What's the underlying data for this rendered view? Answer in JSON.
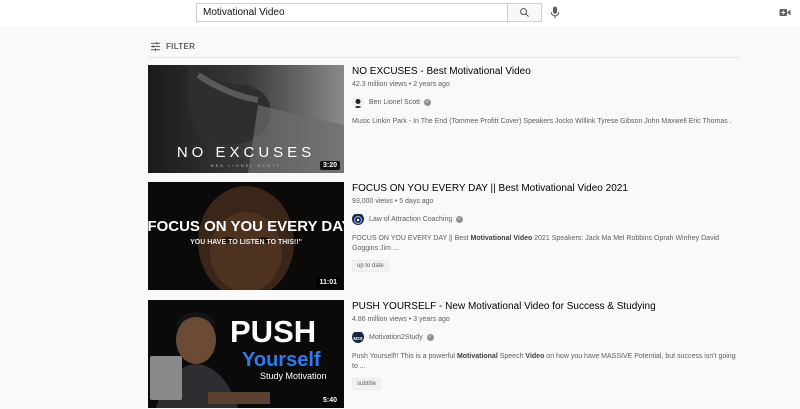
{
  "search": {
    "query": "Motivational Video"
  },
  "filter": {
    "label": "FILTER"
  },
  "results": [
    {
      "title": "NO EXCUSES - Best Motivational Video",
      "views": "42.3 million views",
      "age": "2 years ago",
      "channel": "Ben Lionel Scott",
      "description": "Music Linkin Park - In The End (Tommee Profitt Cover) Speakers Jocko Willink Tyrese Gibson John Maxwell Eric Thomas .",
      "duration": "3:20",
      "thumb_text": "NO EXCUSES",
      "thumb_sub": "BEN LIONEL SCOTT"
    },
    {
      "title": "FOCUS ON YOU EVERY DAY || Best Motivational Video 2021",
      "views": "93,000 views",
      "age": "5 days ago",
      "channel": "Law of Attraction Coaching",
      "desc_pre": "FOCUS ON YOU EVERY DAY || Best ",
      "desc_bold1": "Motivational",
      "desc_sp": " ",
      "desc_bold2": "Video",
      "desc_post": " 2021 Speakers: Jack Ma Mel Robbins Oprah Winfrey David Goggins Jim ...",
      "badge": "up to date",
      "duration": "11:01",
      "thumb_text": "\"FOCUS ON YOU EVERY DAY",
      "thumb_sub": "YOU HAVE TO LISTEN TO THIS!!\""
    },
    {
      "title": "PUSH YOURSELF - New Motivational Video for Success & Studying",
      "views": "4.86 million views",
      "age": "3 years ago",
      "channel": "Motivation2Study",
      "desc_pre": "Push Yourself!! This is a powerful ",
      "desc_bold1": "Motivational",
      "desc_mid": " Speech ",
      "desc_bold2": "Video",
      "desc_post": " on how you have MASSIVE Potential, but success isn't going to ...",
      "badge": "subtitle",
      "duration": "5:40",
      "thumb_text1": "PUSH",
      "thumb_text2": "Yourself",
      "thumb_sub": "Study Motivation"
    }
  ],
  "colors": {
    "accent": "#030303",
    "meta": "#606060",
    "background": "#f9f9f9"
  }
}
